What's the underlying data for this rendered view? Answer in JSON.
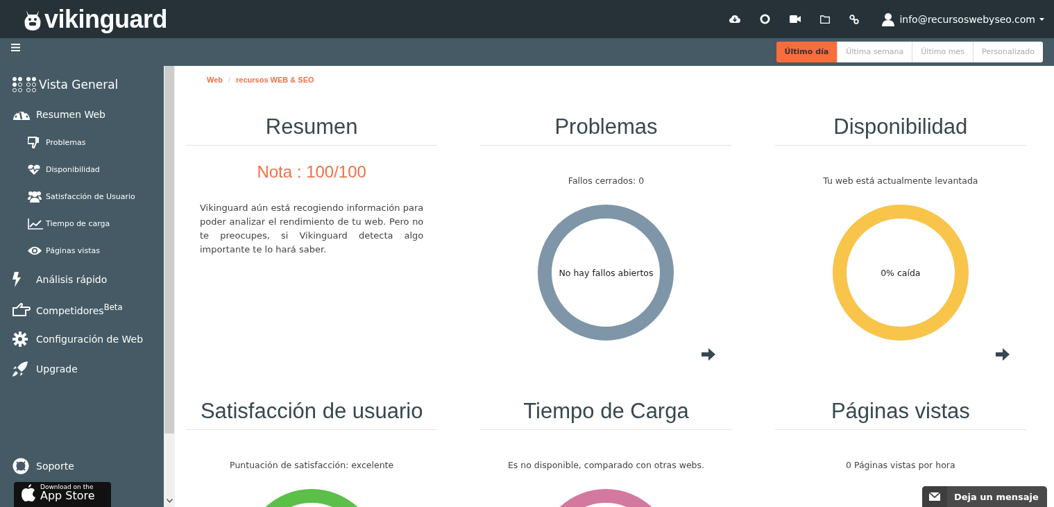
{
  "header": {
    "logo": "vikinguard",
    "user_email": "info@recursoswebyseo.com"
  },
  "time_ranges": [
    {
      "label": "Último día",
      "selected": true
    },
    {
      "label": "Última semana",
      "selected": false
    },
    {
      "label": "Último mes",
      "selected": false
    },
    {
      "label": "Personalizado",
      "selected": false
    }
  ],
  "sidebar": {
    "overview": "Vista General",
    "items": [
      {
        "label": "Resumen Web",
        "children": [
          {
            "label": "Problemas"
          },
          {
            "label": "Disponibilidad"
          },
          {
            "label": "Satisfacción de Usuario"
          },
          {
            "label": "Tiempo de carga"
          },
          {
            "label": "Páginas vistas"
          }
        ]
      },
      {
        "label": "Análisis rápido"
      },
      {
        "label": "Competidores$^{Beta}$"
      },
      {
        "label": "Configuración de Web"
      },
      {
        "label": "Upgrade"
      }
    ],
    "support": "Soporte",
    "app_store": {
      "line_1": "Download on the",
      "line_2": "App Store"
    }
  },
  "breadcrumb": {
    "items": [
      "Web",
      "recursos WEB & SEO"
    ],
    "separator": "/"
  },
  "panels": [
    {
      "kind": "score",
      "title": "Resumen",
      "score": "Nota : 100/100",
      "text": "Vikinguard aún está recogiendo información para poder analizar el rendimiento de tu web. Pero no te preocupes, si Vikinguard detecta algo importante te lo hará saber."
    },
    {
      "kind": "donut",
      "title": "Problemas",
      "subtitle": "Fallos cerrados: 0",
      "center": "No hay fallos abiertos",
      "color": "#7f95a8",
      "arrow": true
    },
    {
      "kind": "donut",
      "title": "Disponibilidad",
      "subtitle": "Tu web está actualmente levantada",
      "center": "0% caída",
      "color": "#f8c44a",
      "arrow": true
    },
    {
      "kind": "donut",
      "title": "Satisfacción de usuario",
      "subtitle": "Puntuación de satisfacción: excelente",
      "color": "#5cbf4a"
    },
    {
      "kind": "donut",
      "title": "Tiempo de Carga",
      "subtitle": "Es no disponible, comparado con otras webs.",
      "color": "#d3799f"
    },
    {
      "kind": "donut",
      "title": "Páginas vistas",
      "subtitle": "0 Páginas vistas por hora"
    }
  ],
  "message_button": "Deja un mensaje"
}
